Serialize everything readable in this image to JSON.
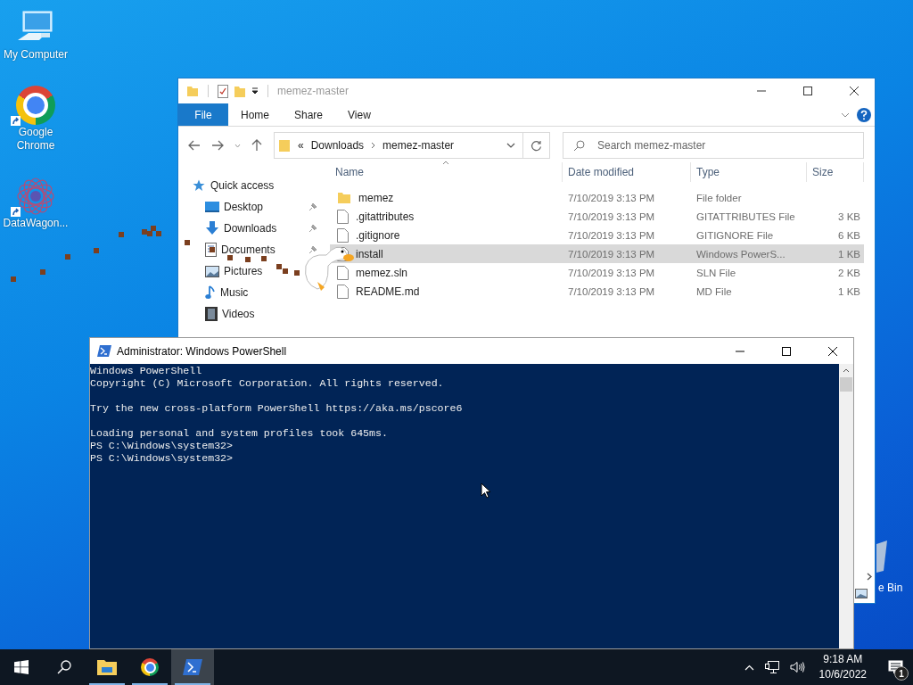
{
  "desktop": {
    "icons": [
      {
        "kind": "computer",
        "label": "My Computer",
        "shortcut": false
      },
      {
        "kind": "chrome",
        "label": "Google Chrome",
        "shortcut": true
      },
      {
        "kind": "mesh",
        "label": "DataWagon...",
        "shortcut": true
      }
    ],
    "recycle_bin": {
      "label": "e Bin"
    }
  },
  "explorer": {
    "title": "memez-master",
    "tabs": [
      {
        "kind": "file_menu",
        "label": "File",
        "selected": false
      },
      {
        "kind": "tab",
        "label": "Home",
        "selected": false
      },
      {
        "kind": "tab",
        "label": "Share",
        "selected": false
      },
      {
        "kind": "tab",
        "label": "View",
        "selected": false
      }
    ],
    "address": {
      "prefix": "«",
      "crumbs": [
        "Downloads",
        "memez-master"
      ]
    },
    "search": {
      "placeholder": "Search memez-master"
    },
    "nav": {
      "header": "Quick access",
      "items": [
        {
          "kind": "desktop",
          "label": "Desktop",
          "pinned": true
        },
        {
          "kind": "downloads",
          "label": "Downloads",
          "pinned": true
        },
        {
          "kind": "documents",
          "label": "Documents",
          "pinned": true
        },
        {
          "kind": "pictures",
          "label": "Pictures",
          "pinned": false
        },
        {
          "kind": "music",
          "label": "Music",
          "pinned": false
        },
        {
          "kind": "videos",
          "label": "Videos",
          "pinned": false
        }
      ]
    },
    "columns": [
      "Name",
      "Date modified",
      "Type",
      "Size"
    ],
    "rows": [
      {
        "kind": "folder",
        "name": "memez",
        "date": "7/10/2019 3:13 PM",
        "type": "File folder",
        "selected": false
      },
      {
        "kind": "file",
        "name": ".gitattributes",
        "date": "7/10/2019 3:13 PM",
        "type": "GITATTRIBUTES File",
        "size": "3 KB",
        "selected": false
      },
      {
        "kind": "file",
        "name": ".gitignore",
        "date": "7/10/2019 3:13 PM",
        "type": "GITIGNORE File",
        "size": "6 KB",
        "selected": false
      },
      {
        "kind": "file",
        "name": "install",
        "date": "7/10/2019 3:13 PM",
        "type": "Windows PowerS...",
        "size": "1 KB",
        "selected": true
      },
      {
        "kind": "file",
        "name": "memez.sln",
        "date": "7/10/2019 3:13 PM",
        "type": "SLN File",
        "size": "2 KB",
        "selected": false
      },
      {
        "kind": "file",
        "name": "README.md",
        "date": "7/10/2019 3:13 PM",
        "type": "MD File",
        "size": "1 KB",
        "selected": false
      }
    ]
  },
  "powershell": {
    "title": "Administrator: Windows PowerShell",
    "blocks": [
      [
        "Windows PowerShell",
        "Copyright (C) Microsoft Corporation. All rights reserved."
      ],
      [
        "Try the new cross-platform PowerShell https://aka.ms/pscore6"
      ],
      [
        "Loading personal and system profiles took 645ms.",
        "PS C:\\Windows\\system32>",
        "PS C:\\Windows\\system32>"
      ]
    ]
  },
  "taskbar": {
    "apps": [
      {
        "kind": "explorer",
        "running": true,
        "active": false
      },
      {
        "kind": "chrome",
        "running": true,
        "active": false
      },
      {
        "kind": "powershell",
        "running": true,
        "active": true
      }
    ],
    "time": "9:18 AM",
    "date": "10/6/2022",
    "notifications": "1"
  }
}
